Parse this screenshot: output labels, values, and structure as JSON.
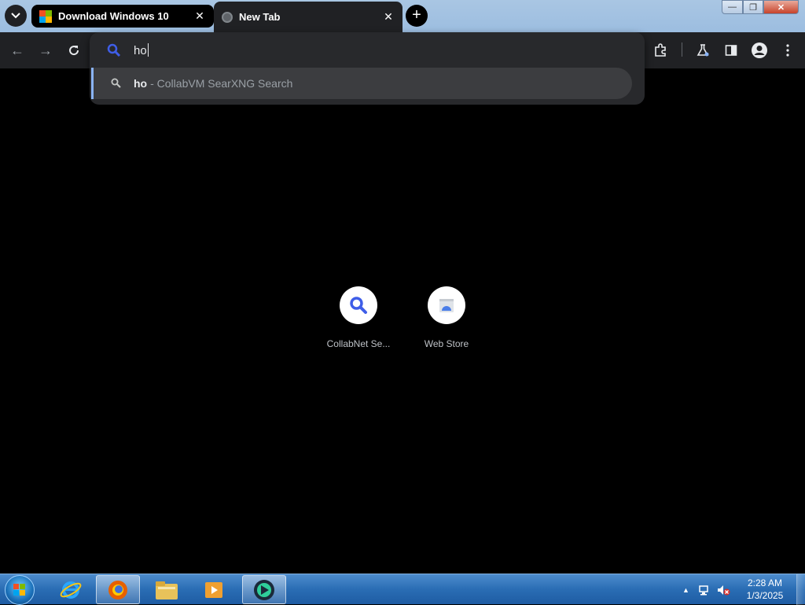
{
  "browser": {
    "tabs": [
      {
        "title": "Download Windows 10",
        "active": false
      },
      {
        "title": "New Tab",
        "active": true
      }
    ],
    "window_controls": {
      "minimize": "—",
      "maximize": "❐",
      "close": "✕"
    }
  },
  "omnibox": {
    "query": "ho",
    "suggestions": [
      {
        "query": "ho",
        "engine_text": "- CollabVM SearXNG Search"
      }
    ]
  },
  "shortcuts": [
    {
      "label": "CollabNet Se...",
      "icon": "search-icon"
    },
    {
      "label": "Web Store",
      "icon": "web-store-icon"
    }
  ],
  "taskbar": {
    "apps": [
      "internet-explorer",
      "firefox",
      "file-explorer",
      "media-player",
      "chrome-like-browser"
    ],
    "clock_time": "2:28 AM",
    "clock_date": "1/3/2025"
  },
  "colors": {
    "accent_blue": "#8ab4f8",
    "search_icon_blue": "#3f5ee8",
    "toolbar_bg": "#202124",
    "dropdown_bg": "#28292c"
  }
}
